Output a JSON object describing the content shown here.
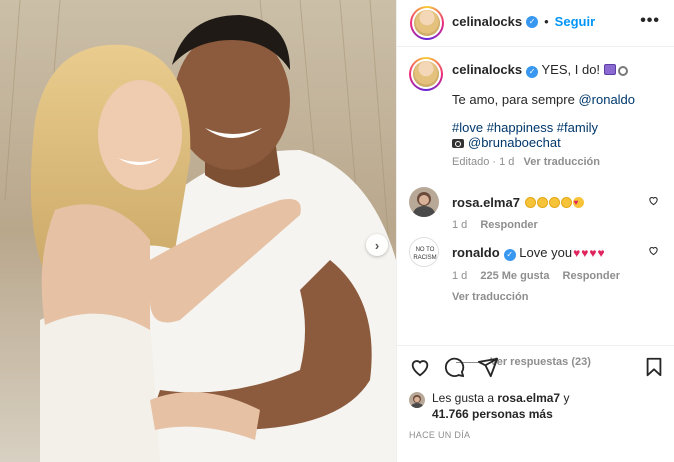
{
  "post": {
    "username": "celinalocks",
    "follow_label": "Seguir",
    "more_label": "•••",
    "next_label": "›"
  },
  "caption": {
    "username": "celinalocks",
    "line1": "YES, I do!",
    "line2_prefix": "Te amo, para sempre ",
    "line2_mention": "@ronaldo",
    "hashtags": "#love #happiness #family",
    "photo_credit": "@brunaboechat",
    "edited": "Editado · 1 d",
    "see_translation": "Ver traducción"
  },
  "comments": [
    {
      "username": "rosa.elma7",
      "time": "1 d",
      "reply_label": "Responder"
    },
    {
      "username": "ronaldo",
      "text": "Love you",
      "time": "1 d",
      "likes": "225 Me gusta",
      "reply_label": "Responder",
      "see_translation": "Ver traducción"
    }
  ],
  "replies": {
    "label": "Ver respuestas (23)"
  },
  "likes": {
    "prefix": "Les gusta a ",
    "user": "rosa.elma7",
    "middle": " y",
    "count": "41.766 personas más"
  },
  "time_ago": "HACE UN DÍA",
  "colors": {
    "accent_blue": "#0095f6",
    "link_blue": "#00376b",
    "muted": "#8e8e8e",
    "heart_red": "#e0245e"
  },
  "icons": [
    "heart-icon",
    "comment-icon",
    "share-icon",
    "bookmark-icon",
    "verified-icon",
    "more-icon",
    "chevron-right-icon"
  ]
}
